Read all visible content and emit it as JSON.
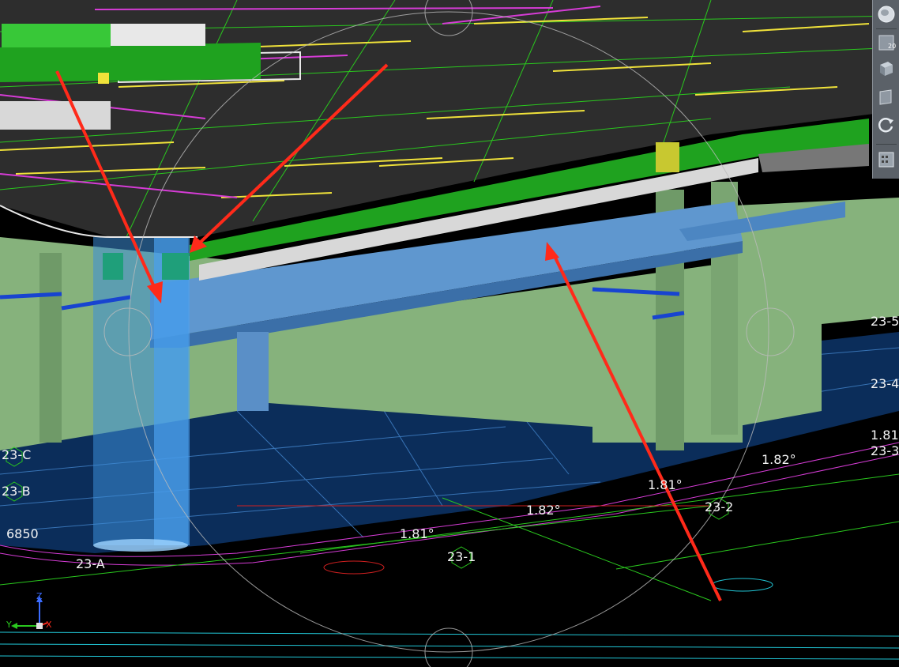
{
  "viewport": {
    "grid_labels": [
      "23-C",
      "23-B",
      "23-A",
      "23-1",
      "23-2",
      "23-3",
      "23-4",
      "23-5"
    ],
    "dimension_label": "6850",
    "angle_labels": [
      "1.81°",
      "1.82°",
      "1.81°",
      "1.82°",
      "1.81"
    ]
  },
  "navigation_bar": {
    "tools": [
      "steering-wheel",
      "pan",
      "zoom",
      "orbit",
      "showmotion"
    ],
    "badge": "20"
  },
  "ucs": {
    "z": "Z",
    "y": "Y",
    "x": "X"
  },
  "colors": {
    "background": "#000000",
    "slab_top": "#2d2d2d",
    "slab_edge": "#1fa21f",
    "wall": "#86b27c",
    "beam": "#5f97cf",
    "floor": "#0b2d5a",
    "annotation_arrow": "#ff2a1a",
    "grid_line": "#2ac81e",
    "magenta_line": "#d63cd6",
    "yellow_line": "#f0e23a"
  }
}
